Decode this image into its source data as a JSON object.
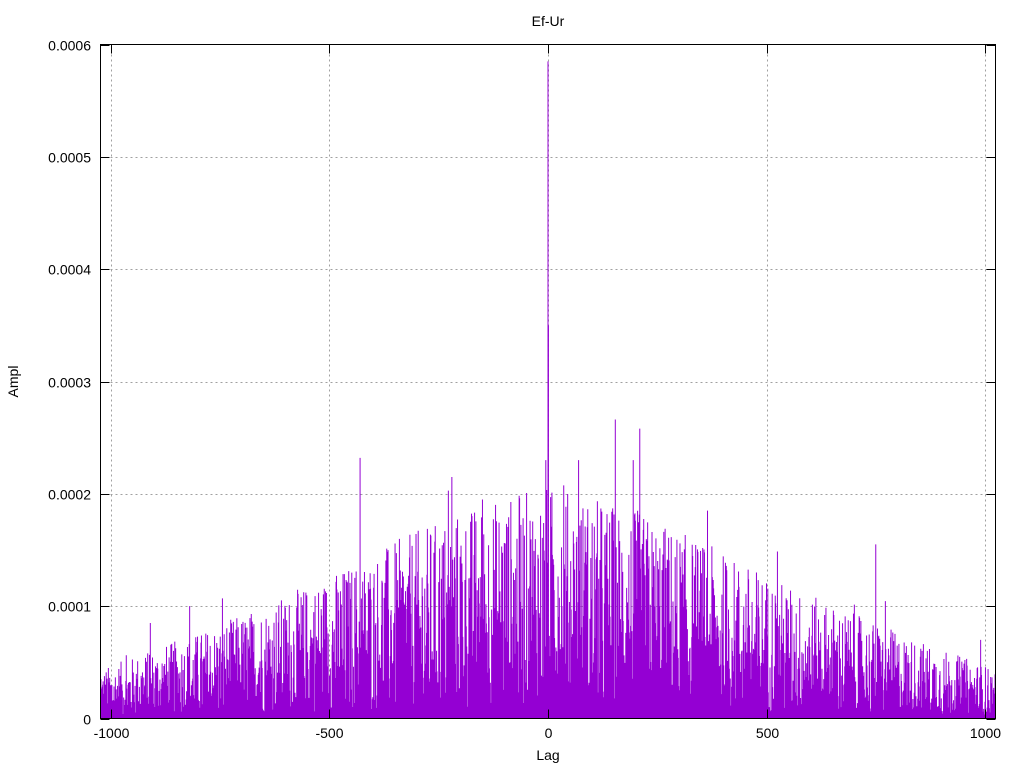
{
  "chart_data": {
    "type": "line",
    "title": "Ef-Ur",
    "xlabel": "Lag",
    "ylabel": "Ampl",
    "xlim": [
      -1024,
      1024
    ],
    "ylim": [
      0,
      0.0006
    ],
    "x_ticks": [
      -1000,
      -500,
      0,
      500,
      1000
    ],
    "x_tick_labels": [
      "-1000",
      "-500",
      "0",
      "500",
      "1000"
    ],
    "y_ticks": [
      0,
      0.0001,
      0.0002,
      0.0003,
      0.0004,
      0.0005,
      0.0006
    ],
    "y_tick_labels": [
      "0",
      "0.0001",
      "0.0002",
      "0.0003",
      "0.0004",
      "0.0005",
      "0.0006"
    ],
    "grid": true,
    "legend": "none",
    "series_color": "#9400d3",
    "series": [
      {
        "style": "impulses",
        "peaks": [
          {
            "x": 0,
            "y": 0.000585
          },
          {
            "x": 1,
            "y": 0.00035
          },
          {
            "x": -5,
            "y": 0.00023
          },
          {
            "x": 70,
            "y": 0.00023
          },
          {
            "x": 210,
            "y": 0.000258
          },
          {
            "x": 195,
            "y": 0.00023
          },
          {
            "x": 365,
            "y": 0.000185
          },
          {
            "x": -430,
            "y": 0.000232
          },
          {
            "x": -220,
            "y": 0.000215
          },
          {
            "x": -150,
            "y": 0.000195
          },
          {
            "x": 750,
            "y": 0.000155
          },
          {
            "x": -910,
            "y": 8.5e-05
          },
          {
            "x": -820,
            "y": 0.0001
          },
          {
            "x": 990,
            "y": 7e-05
          }
        ],
        "envelope": [
          {
            "x": -1024,
            "y": 4e-05
          },
          {
            "x": -800,
            "y": 7e-05
          },
          {
            "x": -600,
            "y": 0.0001
          },
          {
            "x": -400,
            "y": 0.000135
          },
          {
            "x": -200,
            "y": 0.00017
          },
          {
            "x": 0,
            "y": 0.00019
          },
          {
            "x": 200,
            "y": 0.00017
          },
          {
            "x": 400,
            "y": 0.000135
          },
          {
            "x": 600,
            "y": 0.0001
          },
          {
            "x": 800,
            "y": 7e-05
          },
          {
            "x": 1024,
            "y": 4e-05
          }
        ]
      }
    ]
  }
}
